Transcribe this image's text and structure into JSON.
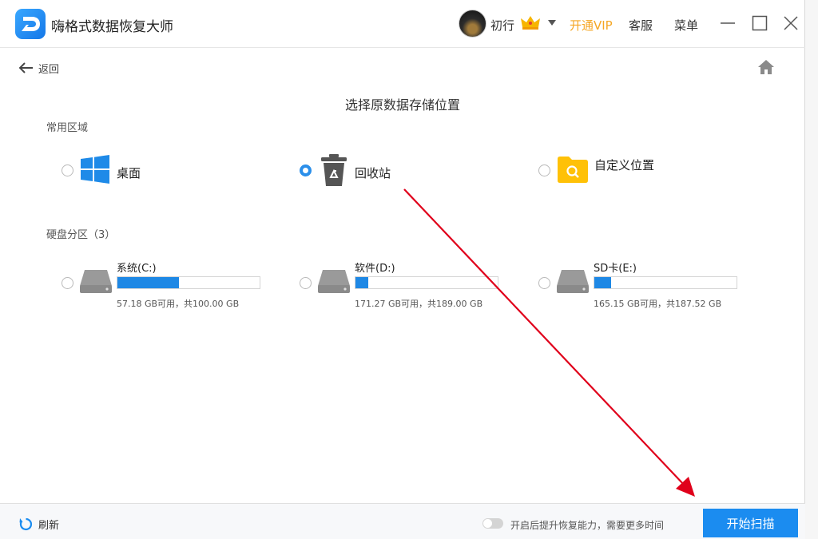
{
  "app": {
    "title": "嗨格式数据恢复大师"
  },
  "header": {
    "username": "初行",
    "vip_label": "开通VIP",
    "service_label": "客服",
    "menu_label": "菜单"
  },
  "nav": {
    "back_label": "返回"
  },
  "page": {
    "heading": "选择原数据存储位置"
  },
  "common_area": {
    "label": "常用区域",
    "items": [
      {
        "label": "桌面",
        "icon": "windows-icon",
        "selected": false
      },
      {
        "label": "回收站",
        "icon": "recycle-bin-icon",
        "selected": true
      },
      {
        "label": "自定义位置",
        "icon": "folder-search-icon",
        "selected": false
      }
    ]
  },
  "drives": {
    "label": "硬盘分区（3）",
    "items": [
      {
        "name": "系统(C:)",
        "info": "57.18 GB可用，共100.00 GB",
        "used_fraction": 0.43
      },
      {
        "name": "软件(D:)",
        "info": "171.27 GB可用，共189.00 GB",
        "used_fraction": 0.09
      },
      {
        "name": "SD卡(E:)",
        "info": "165.15 GB可用，共187.52 GB",
        "used_fraction": 0.12
      }
    ]
  },
  "footer": {
    "refresh_label": "刷新",
    "toggle_label": "开启后提升恢复能力，需要更多时间",
    "toggle_on": false,
    "scan_label": "开始扫描"
  },
  "colors": {
    "accent": "#1b8cf0",
    "vip": "#f5a623",
    "annotation": "#e0001b"
  }
}
